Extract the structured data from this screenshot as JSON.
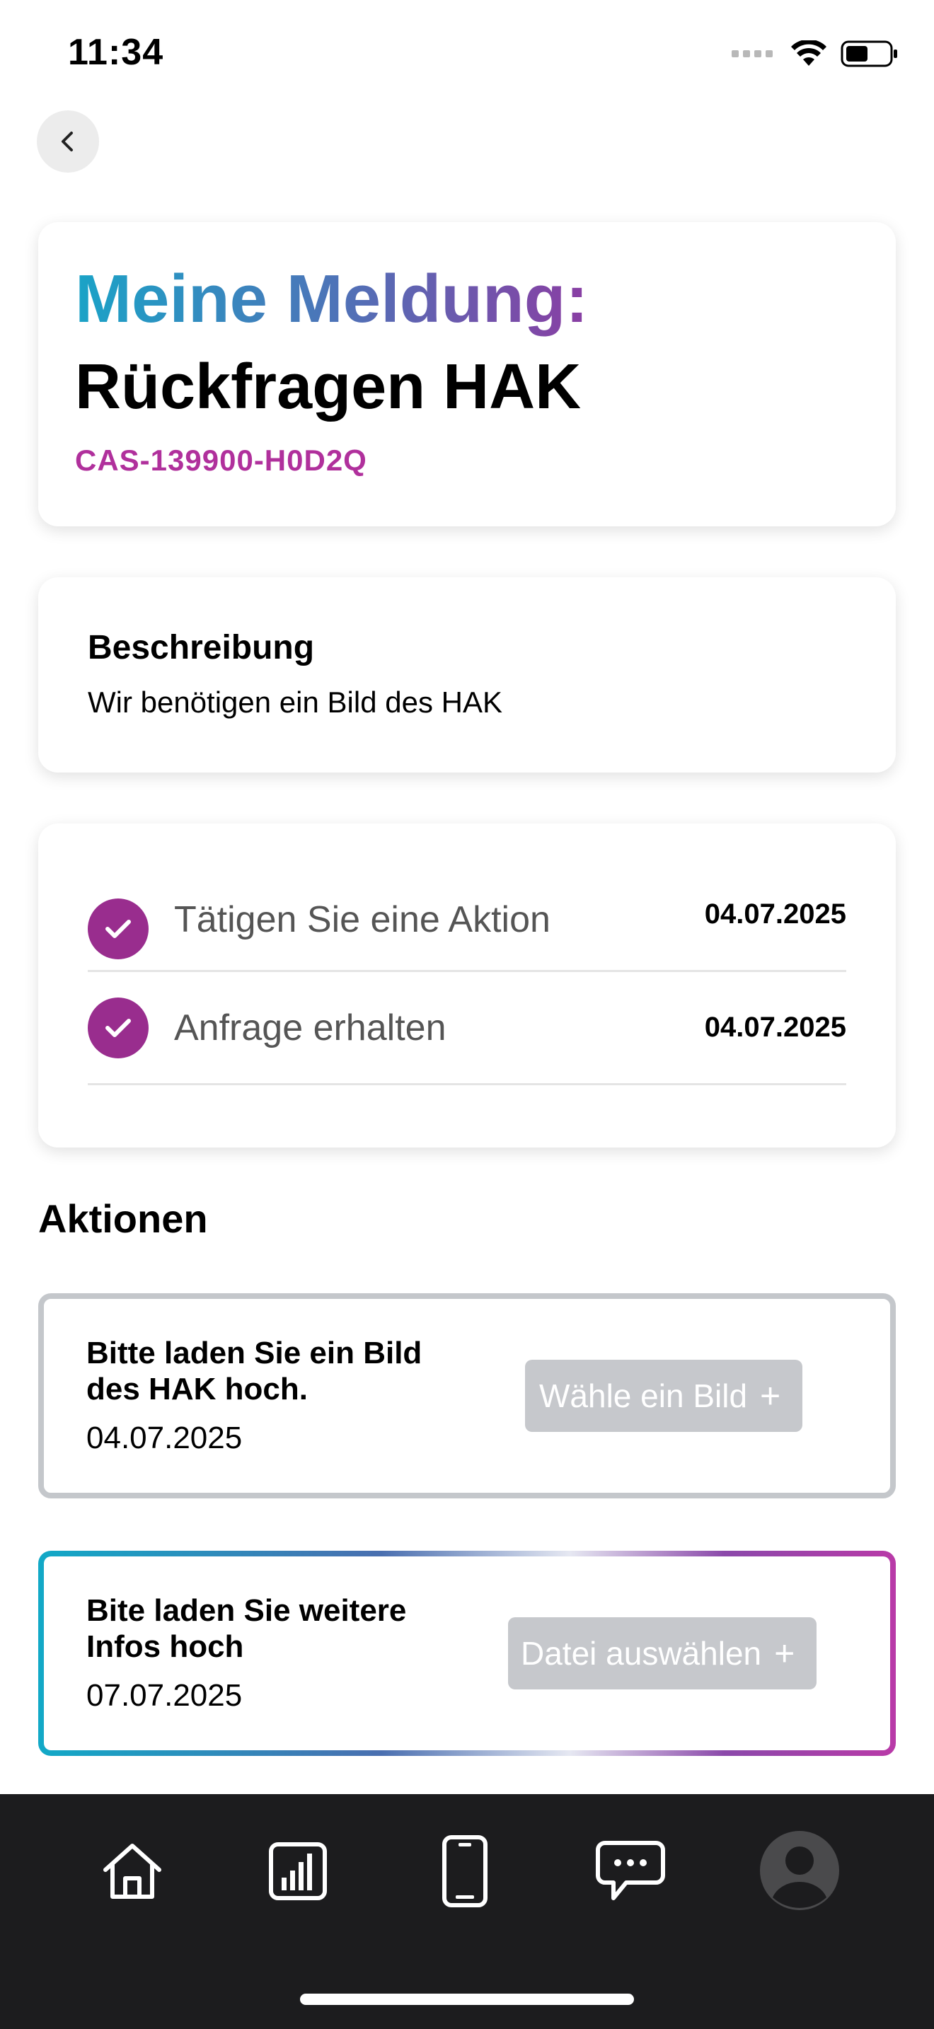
{
  "status_bar": {
    "time": "11:34"
  },
  "header": {
    "title_prefix": "Meine Meldung:",
    "title": "Rückfragen HAK",
    "case_id": "CAS-139900-H0D2Q"
  },
  "description": {
    "label": "Beschreibung",
    "text": "Wir benötigen ein Bild des HAK"
  },
  "timeline": [
    {
      "label": "Tätigen Sie eine Aktion",
      "date": "04.07.2025"
    },
    {
      "label": "Anfrage erhalten",
      "date": "04.07.2025"
    }
  ],
  "actions_heading": "Aktionen",
  "actions": [
    {
      "title_line1": "Bitte laden Sie ein Bild",
      "title_line2": "des HAK hoch.",
      "date": "04.07.2025",
      "button": "Wähle ein Bild",
      "button_icon": "+"
    },
    {
      "title_line1": "Bite laden Sie weitere",
      "title_line2": "Infos hoch",
      "date": "07.07.2025",
      "button": "Datei auswählen",
      "button_icon": "+"
    }
  ],
  "tab_bar": {
    "items": [
      "home-icon",
      "chart-icon",
      "phone-icon",
      "chat-icon",
      "profile-icon"
    ]
  },
  "colors": {
    "accent_purple": "#992d8e",
    "case_id": "#b0309c",
    "gradient_start": "#1aa3c7",
    "gradient_end": "#8a3ea3",
    "tab_bar_bg": "#1c1c1e"
  }
}
